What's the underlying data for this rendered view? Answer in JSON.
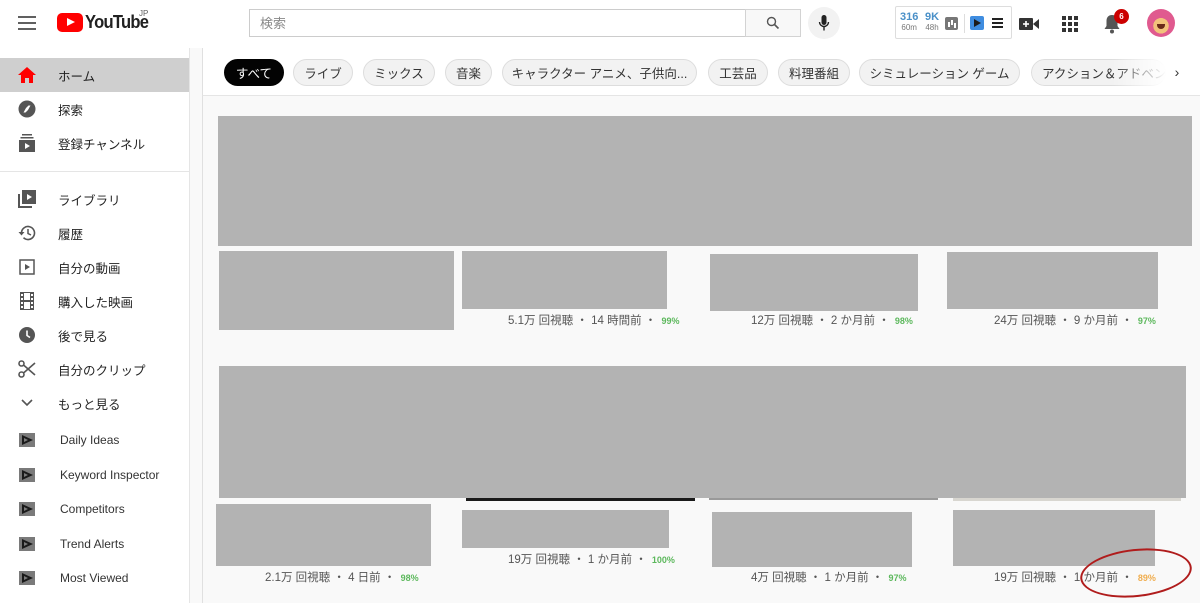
{
  "header": {
    "logo_text": "YouTube",
    "region": "JP",
    "search_placeholder": "検索",
    "extension": {
      "stat1_value": "316",
      "stat1_label": "60m",
      "stat2_value": "9K",
      "stat2_label": "48h"
    },
    "notification_count": "6",
    "icons": {
      "menu": "hamburger-icon",
      "search": "search-icon",
      "mic": "microphone-icon",
      "create": "video-add-icon",
      "apps": "apps-grid-icon",
      "notifications": "bell-icon"
    }
  },
  "sidebar": {
    "main": [
      {
        "label": "ホーム",
        "icon": "home-icon",
        "active": true
      },
      {
        "label": "探索",
        "icon": "compass-icon"
      },
      {
        "label": "登録チャンネル",
        "icon": "subscriptions-icon"
      }
    ],
    "library": [
      {
        "label": "ライブラリ",
        "icon": "library-icon"
      },
      {
        "label": "履歴",
        "icon": "history-icon"
      },
      {
        "label": "自分の動画",
        "icon": "my-videos-icon"
      },
      {
        "label": "購入した映画",
        "icon": "film-icon"
      },
      {
        "label": "後で見る",
        "icon": "clock-icon"
      },
      {
        "label": "自分のクリップ",
        "icon": "scissors-icon"
      },
      {
        "label": "もっと見る",
        "icon": "chevron-down-icon"
      }
    ],
    "extension_items": [
      {
        "label": "Daily Ideas",
        "icon": "extension-play-icon"
      },
      {
        "label": "Keyword Inspector",
        "icon": "extension-play-icon"
      },
      {
        "label": "Competitors",
        "icon": "extension-play-icon"
      },
      {
        "label": "Trend Alerts",
        "icon": "extension-play-icon"
      },
      {
        "label": "Most Viewed",
        "icon": "extension-play-icon"
      }
    ]
  },
  "chips": [
    {
      "label": "すべて",
      "active": true
    },
    {
      "label": "ライブ"
    },
    {
      "label": "ミックス"
    },
    {
      "label": "音楽"
    },
    {
      "label": "キャラクター アニメ、子供向..."
    },
    {
      "label": "工芸品"
    },
    {
      "label": "料理番組"
    },
    {
      "label": "シミュレーション ゲーム"
    },
    {
      "label": "アクション＆アドベンチャー"
    }
  ],
  "videos": [
    {
      "views": "",
      "age": "",
      "score": ""
    },
    {
      "views": "5.1万 回視聴",
      "age": "14 時間前",
      "score": "99%",
      "score_color": "#5cb85c"
    },
    {
      "views": "12万 回視聴",
      "age": "2 か月前",
      "score": "98%",
      "score_color": "#5cb85c"
    },
    {
      "views": "24万 回視聴",
      "age": "9 か月前",
      "score": "97%",
      "score_color": "#5cb85c"
    },
    {
      "views": "2.1万 回視聴",
      "age": "4 日前",
      "score": "98%",
      "score_color": "#5cb85c"
    },
    {
      "views": "19万 回視聴",
      "age": "1 か月前",
      "score": "100%",
      "score_color": "#5cb85c"
    },
    {
      "views": "4万 回視聴",
      "age": "1 か月前",
      "score": "97%",
      "score_color": "#5cb85c"
    },
    {
      "views": "19万 回視聴",
      "age": "1 か月前",
      "score": "89%",
      "score_color": "#f0ad4e"
    }
  ],
  "separator": "・",
  "colors": {
    "brand_red": "#ff0000",
    "annotation_red": "#b01c1c",
    "score_green": "#5cb85c",
    "score_orange": "#f0ad4e"
  }
}
